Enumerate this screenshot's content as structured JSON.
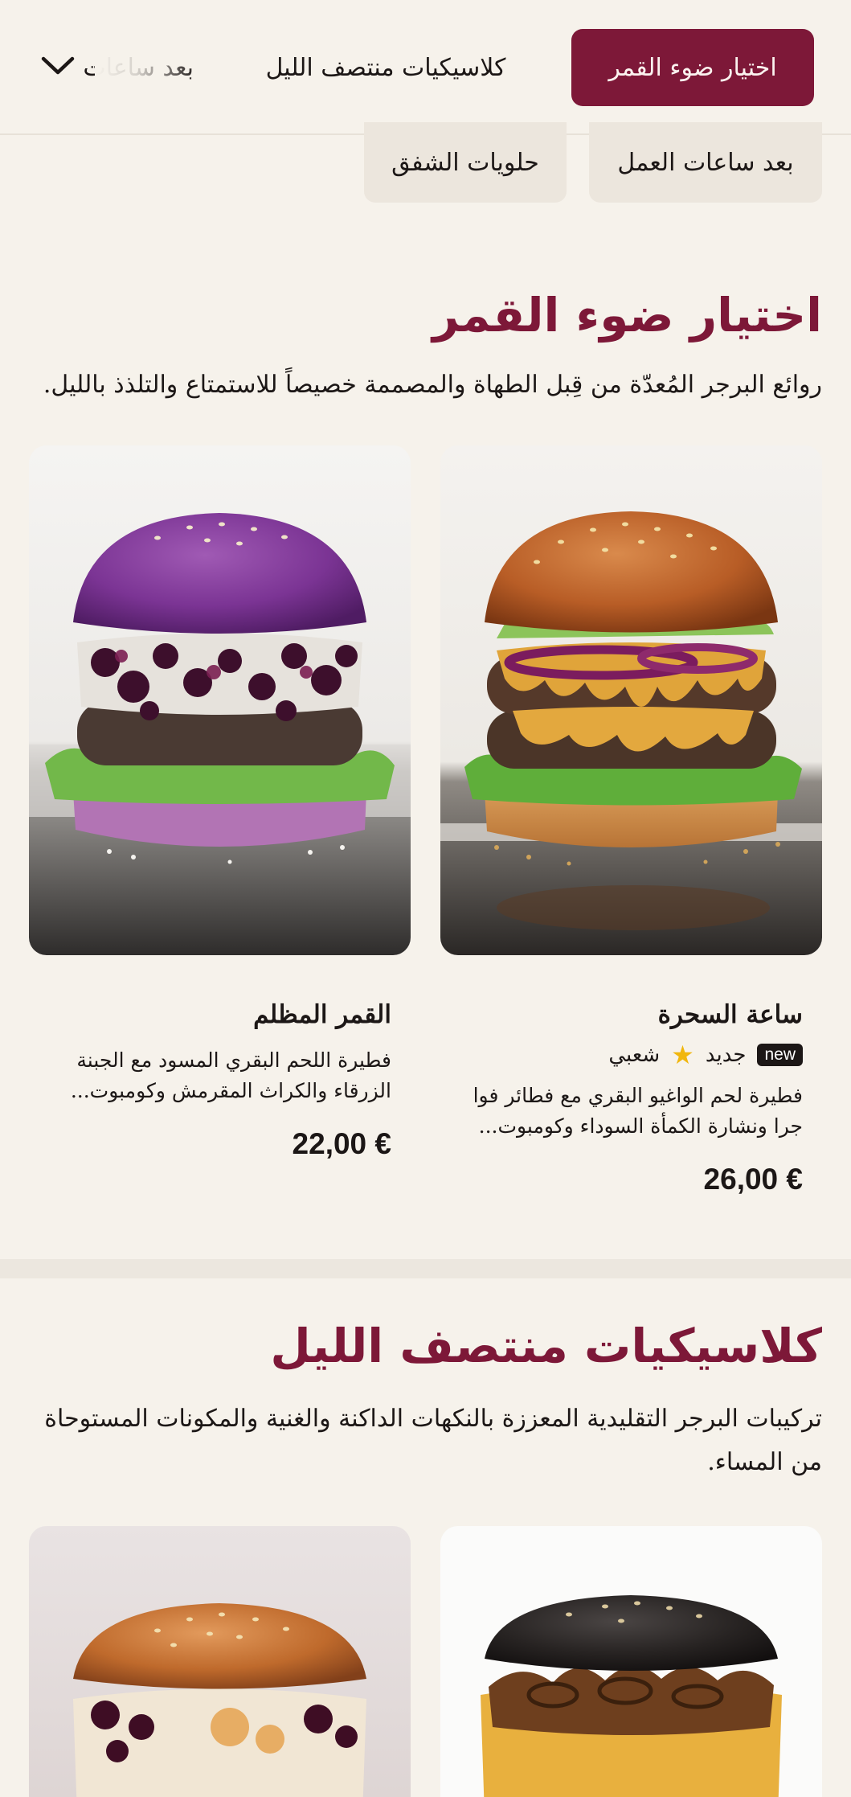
{
  "nav": {
    "tabs": [
      {
        "label": "اختيار ضوء القمر",
        "active": true
      },
      {
        "label": "كلاسيكيات منتصف الليل",
        "active": false
      },
      {
        "label": "بعد ساعات",
        "active": false
      }
    ],
    "more_icon": "chevron-down-icon"
  },
  "chips": [
    {
      "label": "بعد ساعات العمل"
    },
    {
      "label": "حلويات الشفق"
    }
  ],
  "sections": [
    {
      "title": "اختيار ضوء القمر",
      "description": "روائع البرجر المُعدّة من قِبل الطهاة والمصممة خصيصاً للاستمتاع والتلذذ بالليل.",
      "items": [
        {
          "name": "ساعة السحرة",
          "badge_new": "new",
          "badge_new_text": "جديد",
          "badge_popular": "شعبي",
          "description": "فطيرة لحم الواغيو البقري مع فطائر فوا جرا ونشارة الكمأة السوداء وكومبوت...",
          "price": "26,00 €"
        },
        {
          "name": "القمر المظلم",
          "description": "فطيرة اللحم البقري المسود مع الجبنة الزرقاء والكراث المقرمش وكومبوت...",
          "price": "22,00 €"
        }
      ]
    },
    {
      "title": "كلاسيكيات منتصف الليل",
      "description": "تركيبات البرجر التقليدية المعززة بالنكهات الداكنة والغنية والمكونات المستوحاة من المساء."
    }
  ],
  "colors": {
    "accent": "#7d1838",
    "background": "#f6f2eb",
    "chip": "#ece6dd",
    "star": "#f1b70e"
  }
}
